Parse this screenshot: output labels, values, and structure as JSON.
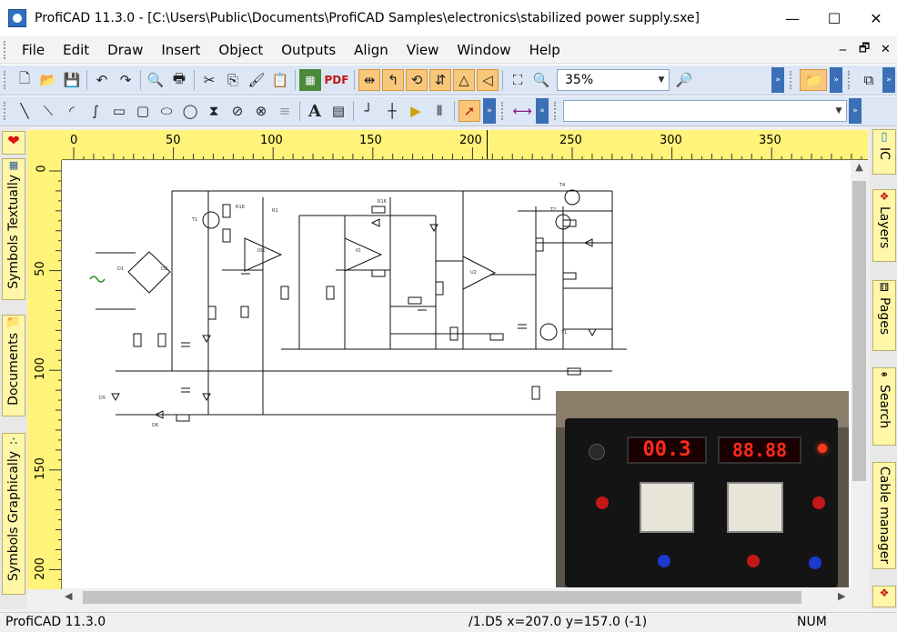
{
  "window": {
    "title": "ProfiCAD 11.3.0 - [C:\\Users\\Public\\Documents\\ProfiCAD Samples\\electronics\\stabilized power supply.sxe]",
    "minimize": "—",
    "maximize": "☐",
    "close": "✕"
  },
  "menu": {
    "items": [
      "File",
      "Edit",
      "Draw",
      "Insert",
      "Object",
      "Outputs",
      "Align",
      "View",
      "Window",
      "Help"
    ],
    "doc_minimize": "‒",
    "doc_restore": "🗗",
    "doc_close": "✕"
  },
  "toolbar1": {
    "zoom_value": "35%",
    "pdf_label": "PDF"
  },
  "toolbar2": {
    "text_tool": "A",
    "combo_value": ""
  },
  "left_tabs": [
    "Symbols Textually",
    "Documents",
    "Symbols Graphically"
  ],
  "right_tabs": [
    "IC",
    "Layers",
    "Pages",
    "Search",
    "Cable manager"
  ],
  "ruler": {
    "top_labels": [
      "0",
      "50",
      "100",
      "150",
      "200",
      "250",
      "300",
      "350"
    ],
    "left_labels": [
      "0",
      "50",
      "100",
      "150",
      "200"
    ]
  },
  "status": {
    "app": "ProfiCAD 11.3.0",
    "coords": "/1.D5  x=207.0  y=157.0 (-1)",
    "num": "NUM"
  },
  "photo": {
    "left_display": "00.3",
    "right_display": "88.88"
  },
  "colors": {
    "toolbar_bg": "#dce6f4",
    "ruler_bg": "#fff37a",
    "highlight": "#f9c77a",
    "accent_blue": "#3b6fb6"
  }
}
